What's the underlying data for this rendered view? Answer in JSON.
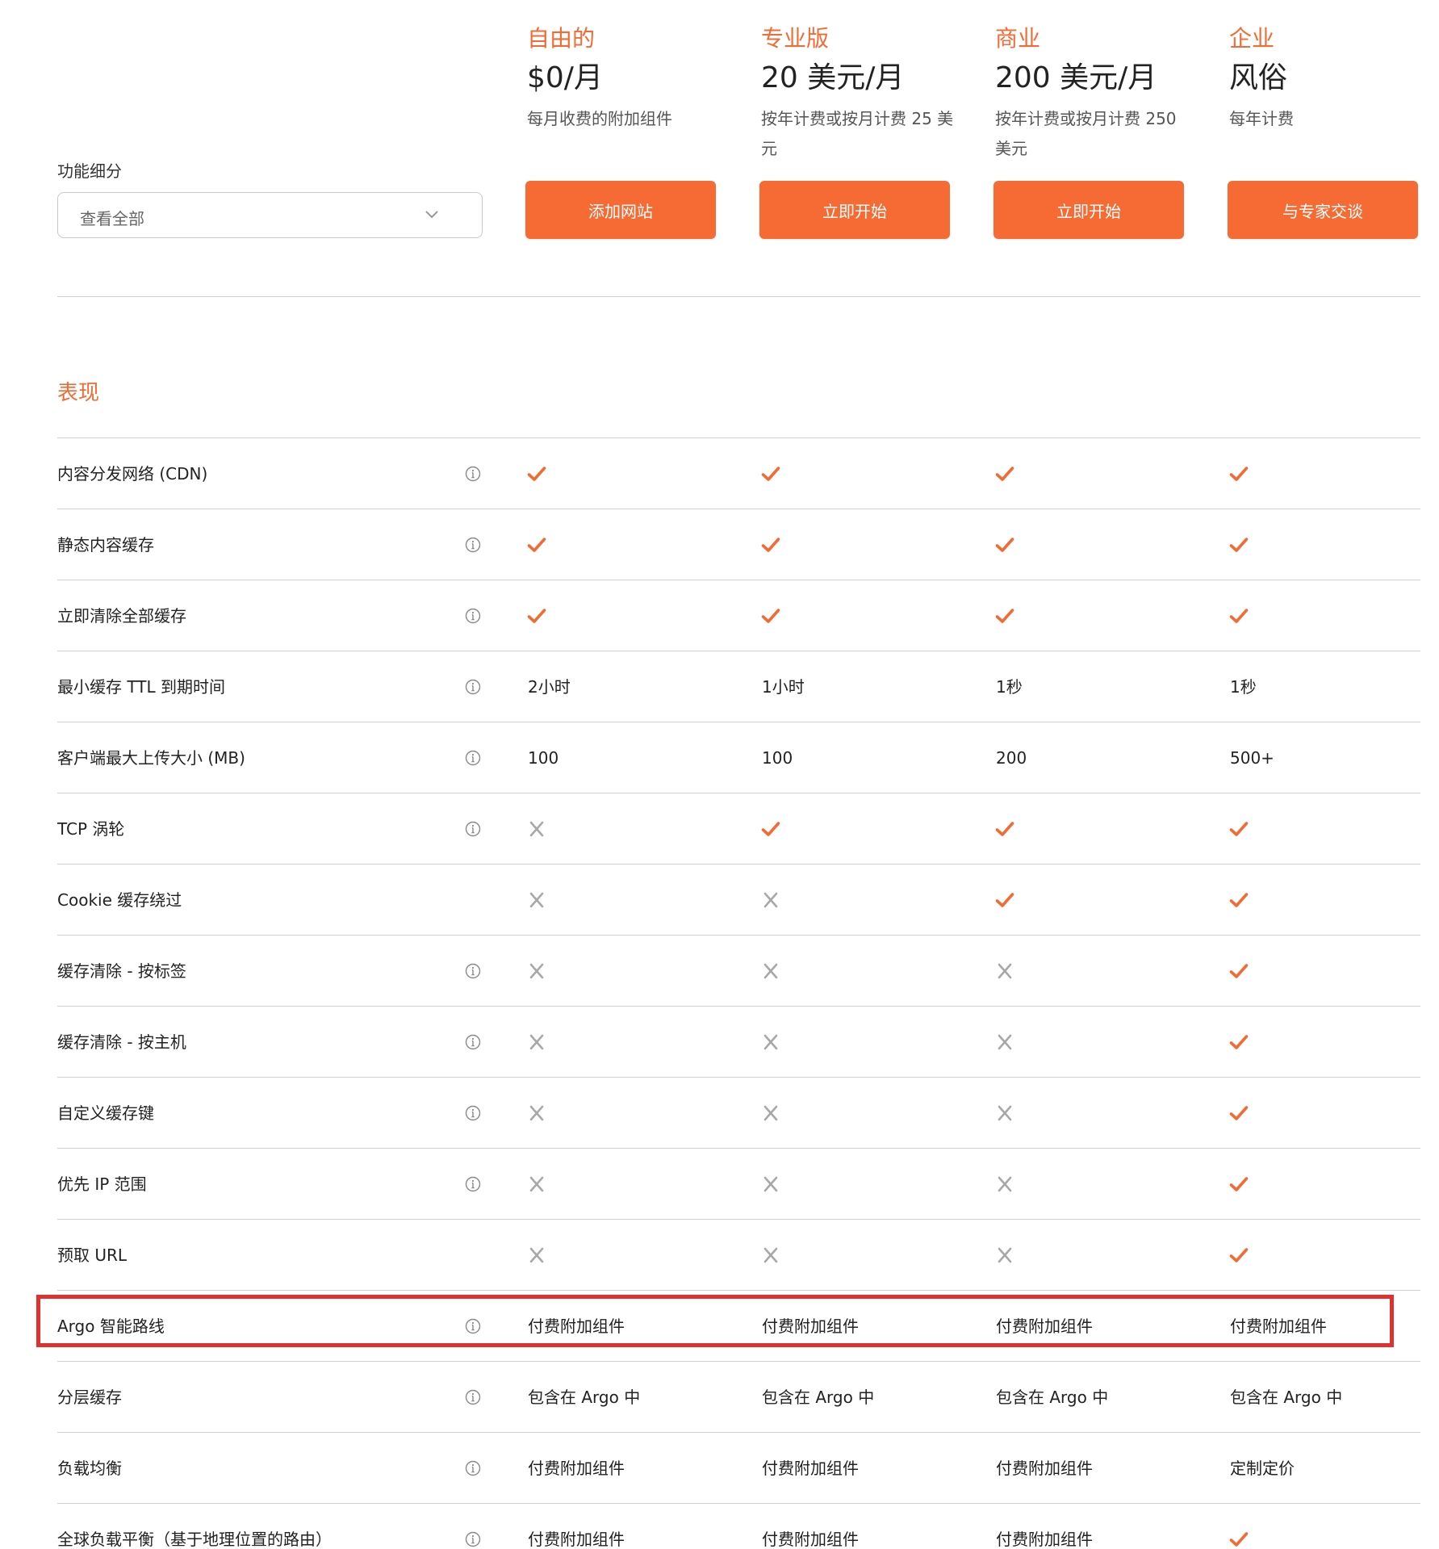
{
  "filter": {
    "label": "功能细分",
    "value": "查看全部"
  },
  "plans": [
    {
      "name": "自由的",
      "price": "$0/月",
      "desc": "每月收费的附加组件",
      "button": "添加网站"
    },
    {
      "name": "专业版",
      "price": "20 美元/月",
      "desc": "按年计费或按月计费 25 美元",
      "button": "立即开始"
    },
    {
      "name": "商业",
      "price": "200 美元/月",
      "desc": "按年计费或按月计费 250 美元",
      "button": "立即开始"
    },
    {
      "name": "企业",
      "price": "风俗",
      "desc": "每年计费",
      "button": "与专家交谈"
    }
  ],
  "section": {
    "title": "表现"
  },
  "rows": [
    {
      "feature": "内容分发网络 (CDN)",
      "info": true,
      "cells": [
        "✓",
        "✓",
        "✓",
        "✓"
      ]
    },
    {
      "feature": "静态内容缓存",
      "info": true,
      "cells": [
        "✓",
        "✓",
        "✓",
        "✓"
      ]
    },
    {
      "feature": "立即清除全部缓存",
      "info": true,
      "cells": [
        "✓",
        "✓",
        "✓",
        "✓"
      ]
    },
    {
      "feature": "最小缓存 TTL 到期时间",
      "info": true,
      "cells": [
        "2小时",
        "1小时",
        "1秒",
        "1秒"
      ]
    },
    {
      "feature": "客户端最大上传大小 (MB)",
      "info": true,
      "cells": [
        "100",
        "100",
        "200",
        "500+"
      ]
    },
    {
      "feature": "TCP 涡轮",
      "info": true,
      "cells": [
        "✗",
        "✓",
        "✓",
        "✓"
      ]
    },
    {
      "feature": "Cookie 缓存绕过",
      "info": false,
      "cells": [
        "✗",
        "✗",
        "✓",
        "✓"
      ]
    },
    {
      "feature": "缓存清除 - 按标签",
      "info": true,
      "cells": [
        "✗",
        "✗",
        "✗",
        "✓"
      ]
    },
    {
      "feature": "缓存清除 - 按主机",
      "info": true,
      "cells": [
        "✗",
        "✗",
        "✗",
        "✓"
      ]
    },
    {
      "feature": "自定义缓存键",
      "info": true,
      "cells": [
        "✗",
        "✗",
        "✗",
        "✓"
      ]
    },
    {
      "feature": "优先 IP 范围",
      "info": true,
      "cells": [
        "✗",
        "✗",
        "✗",
        "✓"
      ]
    },
    {
      "feature": "预取 URL",
      "info": false,
      "cells": [
        "✗",
        "✗",
        "✗",
        "✓"
      ]
    },
    {
      "feature": "Argo 智能路线",
      "info": true,
      "highlighted": true,
      "cells": [
        "付费附加组件",
        "付费附加组件",
        "付费附加组件",
        "付费附加组件"
      ]
    },
    {
      "feature": "分层缓存",
      "info": true,
      "cells": [
        "包含在 Argo 中",
        "包含在 Argo 中",
        "包含在 Argo 中",
        "包含在 Argo 中"
      ]
    },
    {
      "feature": "负载均衡",
      "info": true,
      "cells": [
        "付费附加组件",
        "付费附加组件",
        "付费附加组件",
        "定制定价"
      ]
    },
    {
      "feature": "全球负载平衡（基于地理位置的路由）",
      "info": true,
      "cells": [
        "付费附加组件",
        "付费附加组件",
        "付费附加组件",
        "✓"
      ]
    }
  ],
  "colors": {
    "accent": "#f66a33",
    "check": "#f36b34",
    "cross": "#a8a8a8",
    "highlight_border": "#e0312e"
  },
  "icons": {
    "check": "check-icon",
    "cross": "cross-icon",
    "info": "info-icon",
    "chevron": "chevron-down-icon"
  }
}
